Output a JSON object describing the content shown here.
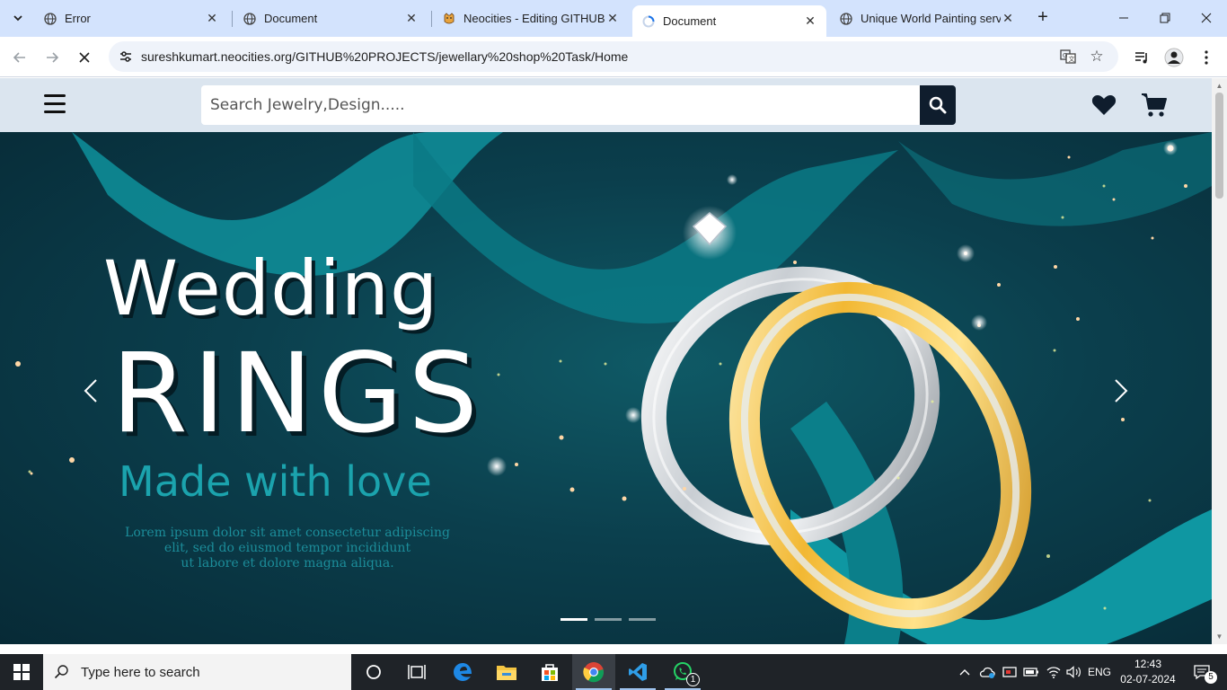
{
  "browser": {
    "tabs": [
      {
        "title": "Error",
        "favicon": "globe-icon",
        "active": false
      },
      {
        "title": "Document",
        "favicon": "globe-icon",
        "active": false
      },
      {
        "title": "Neocities - Editing GITHUB P",
        "favicon": "neocities-cat-icon",
        "active": false
      },
      {
        "title": "Document",
        "favicon": "loading-icon",
        "active": true
      },
      {
        "title": "Unique World Painting servic",
        "favicon": "globe-icon",
        "active": false
      }
    ],
    "url": "sureshkumart.neocities.org/GITHUB%20PROJECTS/jewellary%20shop%20Task/Home"
  },
  "site": {
    "search_placeholder": "Search Jewelry,Design.....",
    "header_icons": [
      "menu-icon",
      "search-icon",
      "heart-icon",
      "cart-icon"
    ]
  },
  "hero": {
    "title_line1": "Wedding",
    "title_line2": "RINGS",
    "subtitle": "Made with love",
    "body_line1": "Lorem ipsum dolor sit amet  consectetur adipiscing",
    "body_line2": "elit, sed do eiusmod tempor incididunt",
    "body_line3": "ut labore et dolore magna aliqua.",
    "slides": 3,
    "active_slide": 1,
    "colors": {
      "background": "#0b3f4d",
      "accent": "#1ba3ad",
      "text": "#ffffff"
    }
  },
  "taskbar": {
    "search_label": "Type here to search",
    "language": "ENG",
    "time": "12:43",
    "date": "02-07-2024",
    "notification_count": "5",
    "whatsapp_badge": "1"
  }
}
